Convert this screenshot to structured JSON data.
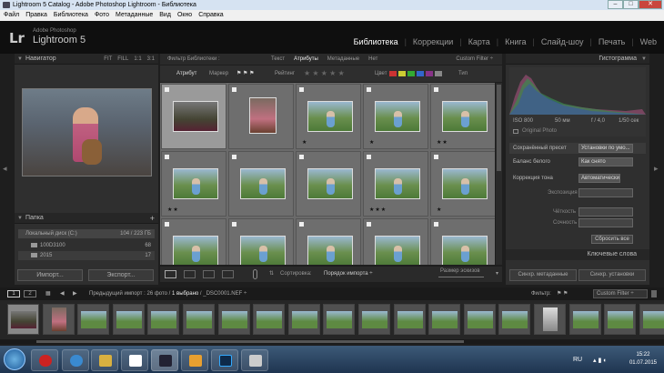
{
  "window": {
    "title": "Lightroom 5 Catalog - Adobe Photoshop Lightroom - Библиотека",
    "min": "–",
    "max": "□",
    "close": "✕"
  },
  "menu": [
    "Файл",
    "Правка",
    "Библиотека",
    "Фото",
    "Метаданные",
    "Вид",
    "Окно",
    "Справка"
  ],
  "brand": {
    "logo": "Lr",
    "line1": "Adobe Photoshop",
    "line2": "Lightroom 5"
  },
  "modules": [
    "Библиотека",
    "Коррекции",
    "Карта",
    "Книга",
    "Слайд-шоу",
    "Печать",
    "Web"
  ],
  "navigator": {
    "title": "Навигатор",
    "opts": [
      "FIT",
      "FILL",
      "1:1",
      "3:1"
    ]
  },
  "folders": {
    "title": "Папка",
    "disk": "Локальный диск (C:)",
    "disk_info": "104 / 223 ГБ",
    "items": [
      {
        "name": "100D3100",
        "count": "68"
      },
      {
        "name": "2015",
        "count": "17"
      }
    ],
    "plus": "+"
  },
  "left_buttons": {
    "import": "Импорт...",
    "export": "Экспорт..."
  },
  "filter": {
    "title": "Фильтр Библиотеки :",
    "tabs": [
      "Текст",
      "Атрибуты",
      "Метаданные",
      "Нет"
    ],
    "active_tab": "Атрибуты",
    "custom": "Custom Filter ÷"
  },
  "attrbar": {
    "attr": "Атрибут",
    "mark": "Маркер",
    "rating": "Рейтинг",
    "color": "Цвет",
    "type": "Тип",
    "rating_stars": "★ ★ ★ ★ ★"
  },
  "grid": {
    "rows": [
      [
        {
          "sel": true,
          "kind": "dark",
          "stars": ""
        },
        {
          "kind": "pink",
          "stars": ""
        },
        {
          "kind": "land",
          "stars": "★"
        },
        {
          "kind": "land",
          "stars": "★"
        },
        {
          "kind": "land",
          "stars": "★★"
        }
      ],
      [
        {
          "kind": "land",
          "stars": "★★"
        },
        {
          "kind": "land",
          "stars": ""
        },
        {
          "kind": "land",
          "stars": ""
        },
        {
          "kind": "land",
          "stars": "★★★"
        },
        {
          "kind": "land",
          "stars": "★"
        }
      ],
      [
        {
          "kind": "land",
          "stars": ""
        },
        {
          "kind": "land",
          "stars": ""
        },
        {
          "kind": "land",
          "stars": ""
        },
        {
          "kind": "land",
          "stars": ""
        },
        {
          "kind": "land",
          "stars": ""
        }
      ]
    ]
  },
  "toolbar": {
    "sort_label": "Сортировка:",
    "sort_value": "Порядок импорта ÷",
    "size": "Размер эскизов"
  },
  "histogram": {
    "title": "Гистограмма",
    "iso": "ISO 800",
    "focal": "50 мм",
    "aperture": "f / 4,0",
    "shutter": "1/50 сек",
    "original": "Original Photo"
  },
  "quick": {
    "preset_label": "Сохранённый пресет",
    "preset_value": "Установки по умо...",
    "wb_label": "Баланс белого",
    "wb_value": "Как снято",
    "tone_label": "Коррекция тона",
    "tone_value": "Автоматически",
    "exposure": "Экспозиция",
    "clarity": "Чёткость",
    "vibrance": "Сочность",
    "reset": "Сбросить все"
  },
  "keywords": "Ключевые слова",
  "right_buttons": {
    "sync_meta": "Синхр. метаданные",
    "sync_settings": "Синхр. установки"
  },
  "filmbar": {
    "pages": [
      "1",
      "2"
    ],
    "status_prefix": "Предыдущий импорт : 26 фото / ",
    "status_sel": "1 выбрано",
    "status_file": " / _DSC0001.NEF ÷",
    "filter_label": "Фильтр:",
    "filter_value": "Custom Filter ÷"
  },
  "taskbar": {
    "lang": "RU",
    "time": "15:22",
    "date": "01.07.2015"
  }
}
